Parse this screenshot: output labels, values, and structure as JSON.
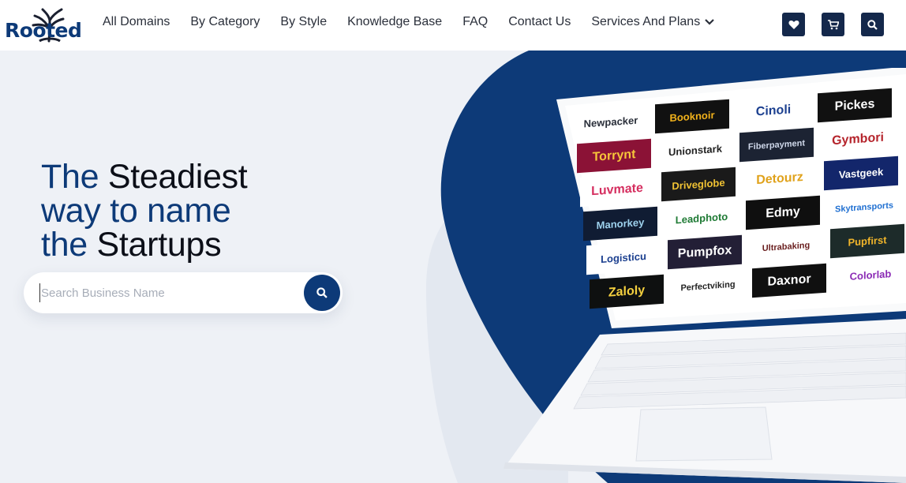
{
  "brand": {
    "name": "Rooted",
    "color": "#0d3a78"
  },
  "nav": {
    "items": [
      {
        "label": "All Domains"
      },
      {
        "label": "By Category"
      },
      {
        "label": "By Style"
      },
      {
        "label": "Knowledge Base"
      },
      {
        "label": "FAQ"
      },
      {
        "label": "Contact Us"
      },
      {
        "label": "Services And Plans"
      }
    ],
    "icons": [
      "heart-icon",
      "cart-icon",
      "search-icon"
    ]
  },
  "hero": {
    "line1_a": "The ",
    "line1_b": "Steadiest",
    "line2_a": "way to ",
    "line2_b": "name",
    "line3_a": "the ",
    "line3_b": "Startups"
  },
  "search": {
    "placeholder": "Search Business Name",
    "value": ""
  },
  "laptop_logos": [
    {
      "text": "Newpacker",
      "bg": "#ffffff",
      "fg": "#2a2f3a"
    },
    {
      "text": "Booknoir",
      "bg": "#111111",
      "fg": "#f2b21b"
    },
    {
      "text": "Cinoli",
      "bg": "#ffffff",
      "fg": "#1b3f8f"
    },
    {
      "text": "Pickes",
      "bg": "#111111",
      "fg": "#ffffff"
    },
    {
      "text": "Torrynt",
      "bg": "#8b1236",
      "fg": "#f6c53a"
    },
    {
      "text": "Unionstark",
      "bg": "#ffffff",
      "fg": "#222222"
    },
    {
      "text": "Fiberpayment",
      "bg": "#1c2333",
      "fg": "#cfd8ea"
    },
    {
      "text": "Gymbori",
      "bg": "#ffffff",
      "fg": "#b5242c"
    },
    {
      "text": "Luvmate",
      "bg": "#ffffff",
      "fg": "#d52e5f"
    },
    {
      "text": "Driveglobe",
      "bg": "#1a1a1a",
      "fg": "#f0c233"
    },
    {
      "text": "Detourz",
      "bg": "#ffffff",
      "fg": "#e0a21b"
    },
    {
      "text": "Vastgeek",
      "bg": "#13266b",
      "fg": "#ffffff"
    },
    {
      "text": "Manorkey",
      "bg": "#101c33",
      "fg": "#9ed2ee"
    },
    {
      "text": "Leadphoto",
      "bg": "#ffffff",
      "fg": "#1e7a34"
    },
    {
      "text": "Edmy",
      "bg": "#0f0f0f",
      "fg": "#ffffff"
    },
    {
      "text": "Skytransports",
      "bg": "#ffffff",
      "fg": "#1f6fd1"
    },
    {
      "text": "Logisticu",
      "bg": "#ffffff",
      "fg": "#1b3f8f"
    },
    {
      "text": "Pumpfox",
      "bg": "#231f36",
      "fg": "#ffffff"
    },
    {
      "text": "Ultrabaking",
      "bg": "#ffffff",
      "fg": "#6a1f1f"
    },
    {
      "text": "Pupfirst",
      "bg": "#1d2b2a",
      "fg": "#f1b52a"
    },
    {
      "text": "Zaloly",
      "bg": "#0e1010",
      "fg": "#f4d03f"
    },
    {
      "text": "Perfectviking",
      "bg": "#ffffff",
      "fg": "#222222"
    },
    {
      "text": "Daxnor",
      "bg": "#101010",
      "fg": "#ffffff"
    },
    {
      "text": "Colorlab",
      "bg": "#ffffff",
      "fg": "#8b2bb5"
    }
  ],
  "colors": {
    "navy": "#0d3a78",
    "bg": "#eef1f6",
    "icon_bg": "#14284b"
  }
}
